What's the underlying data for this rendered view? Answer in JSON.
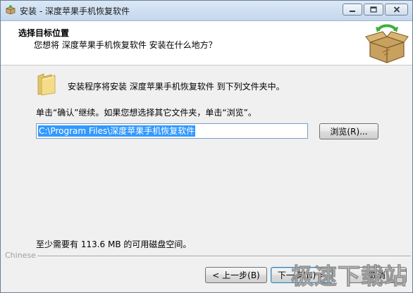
{
  "window": {
    "title": "安装 - 深度苹果手机恢复软件",
    "icon": "installer-box-icon"
  },
  "header": {
    "title": "选择目标位置",
    "subtitle": "您想将 深度苹果手机恢复软件 安装在什么地方？",
    "logo_icon": "open-box-icon"
  },
  "body": {
    "intro": "安装程序将安装 深度苹果手机恢复软件 到下列文件夹中。",
    "instruction": "单击“确认”继续。如果您想选择其它文件夹，单击“浏览”。",
    "install_path": "C:\\Program Files\\深度苹果手机恢复软件",
    "browse_label": "浏览(R)...",
    "disk_space": "至少需要有 113.6 MB 的可用磁盘空间。"
  },
  "footer": {
    "language": "Chinese",
    "back_label": "< 上一步(B)",
    "next_label": "下一步(N) >",
    "cancel_label": "取消"
  },
  "watermark": "极速下载站",
  "colors": {
    "selection": "#3399ff",
    "titlebar_top": "#dbe8f6",
    "titlebar_bottom": "#c4d7ec",
    "dialog_bg": "#f0f0f0"
  }
}
